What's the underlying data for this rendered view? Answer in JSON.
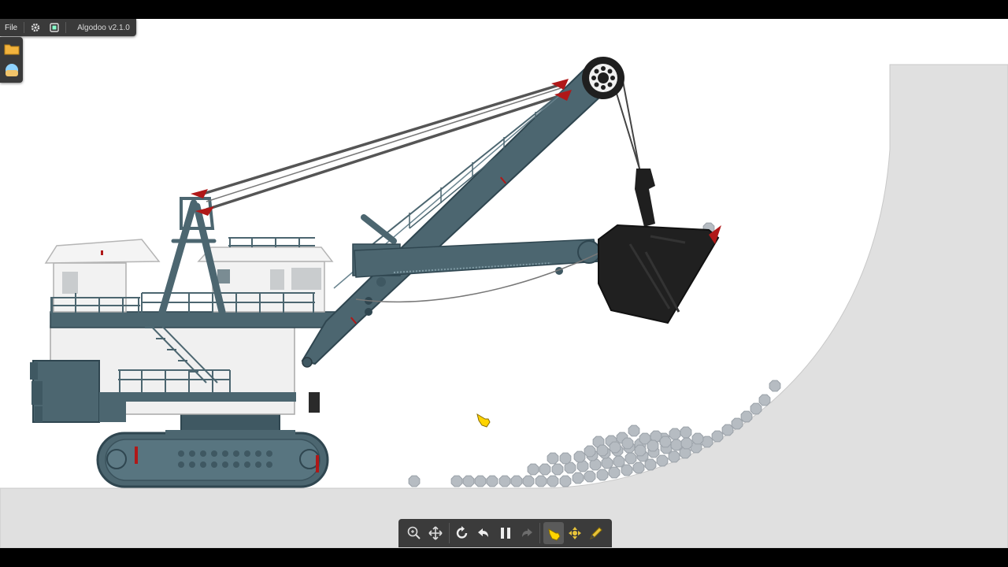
{
  "app": {
    "file_menu": "File",
    "settings_icon": "gear-icon",
    "view_icon": "window-icon",
    "title": "Algodoo v2.1.0"
  },
  "side_panel": {
    "items": [
      {
        "icon": "folder-icon",
        "label": "Open"
      },
      {
        "icon": "scene-preview-icon",
        "label": "Scene"
      }
    ]
  },
  "toolbar": {
    "buttons": [
      {
        "icon": "zoom-icon",
        "active": false
      },
      {
        "icon": "pan-move-icon",
        "active": false
      },
      {
        "icon": "reset-icon",
        "active": false
      },
      {
        "icon": "undo-icon",
        "active": false
      },
      {
        "icon": "pause-icon",
        "active": false
      },
      {
        "icon": "redo-icon",
        "active": false
      },
      {
        "icon": "hand-drag-icon",
        "active": true
      },
      {
        "icon": "move-tool-icon",
        "active": false
      },
      {
        "icon": "sketch-pencil-icon",
        "active": false
      }
    ]
  },
  "colors": {
    "machine": "#4c6670",
    "ground": "#e0e0e0",
    "background": "#ffffff",
    "bucket": "#1f1f1f",
    "accent_red": "#b01818",
    "rocks": "#b6bcc2"
  }
}
